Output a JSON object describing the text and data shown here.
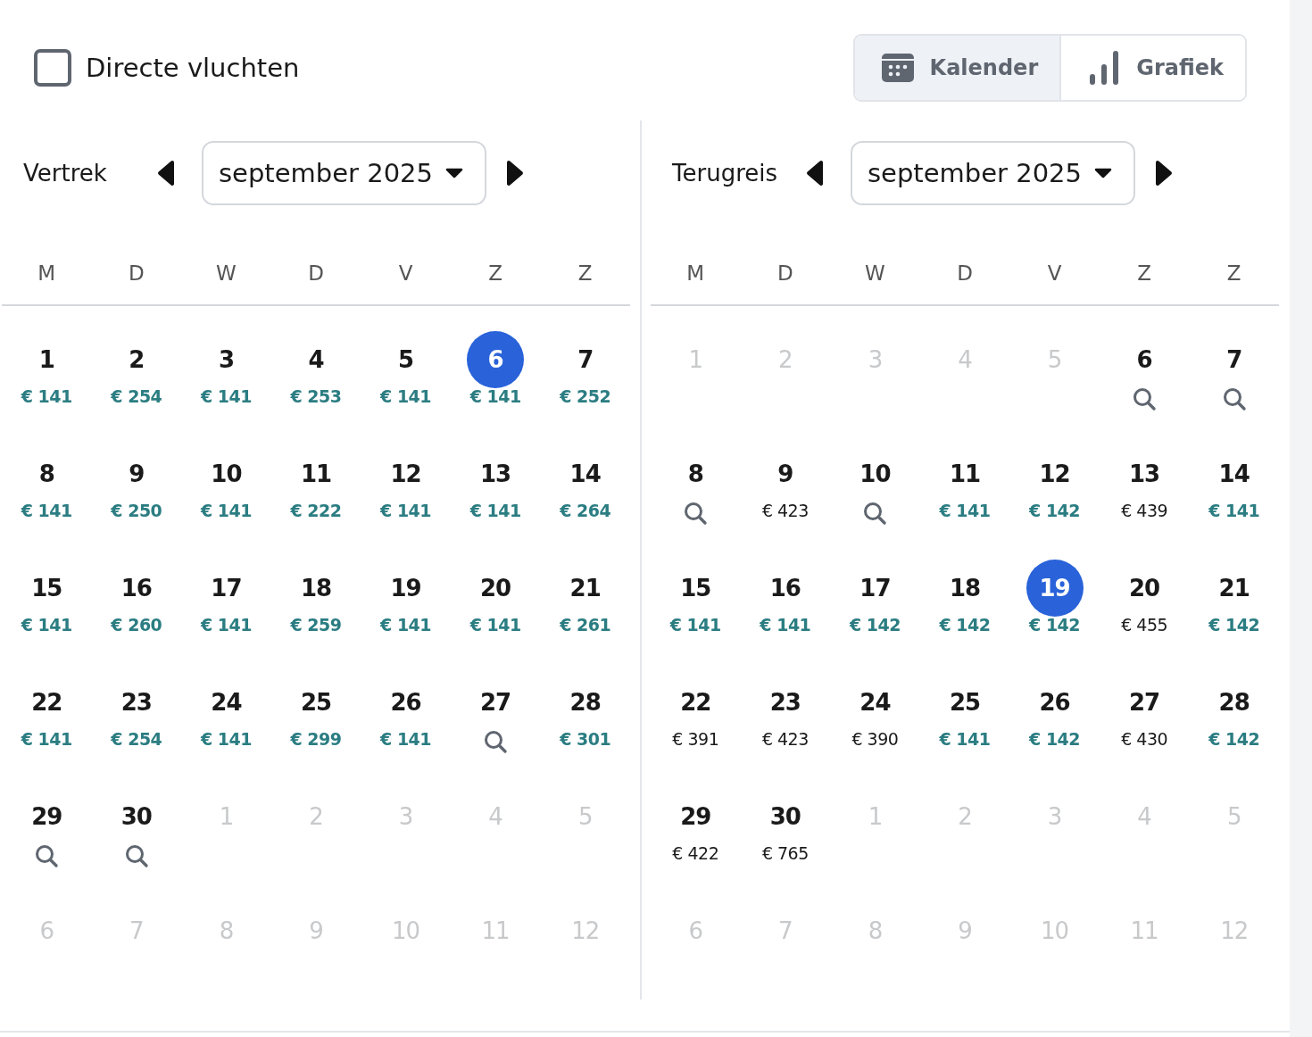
{
  "direct_flights": {
    "label": "Directe vluchten",
    "checked": false
  },
  "view_tabs": [
    {
      "label": "Kalender",
      "selected": true
    },
    {
      "label": "Grafiek",
      "selected": false
    }
  ],
  "calendars": [
    {
      "label": "Vertrek",
      "month": "september 2025",
      "weekdays": [
        "M",
        "D",
        "W",
        "D",
        "V",
        "Z",
        "Z"
      ],
      "days": [
        {
          "day": "1",
          "kind": "price",
          "price": "€ 141",
          "cheap": true,
          "selected": false
        },
        {
          "day": "2",
          "kind": "price",
          "price": "€ 254",
          "cheap": true,
          "selected": false
        },
        {
          "day": "3",
          "kind": "price",
          "price": "€ 141",
          "cheap": true,
          "selected": false
        },
        {
          "day": "4",
          "kind": "price",
          "price": "€ 253",
          "cheap": true,
          "selected": false
        },
        {
          "day": "5",
          "kind": "price",
          "price": "€ 141",
          "cheap": true,
          "selected": false
        },
        {
          "day": "6",
          "kind": "price",
          "price": "€ 141",
          "cheap": true,
          "selected": true
        },
        {
          "day": "7",
          "kind": "price",
          "price": "€ 252",
          "cheap": true,
          "selected": false
        },
        {
          "day": "8",
          "kind": "price",
          "price": "€ 141",
          "cheap": true,
          "selected": false
        },
        {
          "day": "9",
          "kind": "price",
          "price": "€ 250",
          "cheap": true,
          "selected": false
        },
        {
          "day": "10",
          "kind": "price",
          "price": "€ 141",
          "cheap": true,
          "selected": false
        },
        {
          "day": "11",
          "kind": "price",
          "price": "€ 222",
          "cheap": true,
          "selected": false
        },
        {
          "day": "12",
          "kind": "price",
          "price": "€ 141",
          "cheap": true,
          "selected": false
        },
        {
          "day": "13",
          "kind": "price",
          "price": "€ 141",
          "cheap": true,
          "selected": false
        },
        {
          "day": "14",
          "kind": "price",
          "price": "€ 264",
          "cheap": true,
          "selected": false
        },
        {
          "day": "15",
          "kind": "price",
          "price": "€ 141",
          "cheap": true,
          "selected": false
        },
        {
          "day": "16",
          "kind": "price",
          "price": "€ 260",
          "cheap": true,
          "selected": false
        },
        {
          "day": "17",
          "kind": "price",
          "price": "€ 141",
          "cheap": true,
          "selected": false
        },
        {
          "day": "18",
          "kind": "price",
          "price": "€ 259",
          "cheap": true,
          "selected": false
        },
        {
          "day": "19",
          "kind": "price",
          "price": "€ 141",
          "cheap": true,
          "selected": false
        },
        {
          "day": "20",
          "kind": "price",
          "price": "€ 141",
          "cheap": true,
          "selected": false
        },
        {
          "day": "21",
          "kind": "price",
          "price": "€ 261",
          "cheap": true,
          "selected": false
        },
        {
          "day": "22",
          "kind": "price",
          "price": "€ 141",
          "cheap": true,
          "selected": false
        },
        {
          "day": "23",
          "kind": "price",
          "price": "€ 254",
          "cheap": true,
          "selected": false
        },
        {
          "day": "24",
          "kind": "price",
          "price": "€ 141",
          "cheap": true,
          "selected": false
        },
        {
          "day": "25",
          "kind": "price",
          "price": "€ 299",
          "cheap": true,
          "selected": false
        },
        {
          "day": "26",
          "kind": "price",
          "price": "€ 141",
          "cheap": true,
          "selected": false
        },
        {
          "day": "27",
          "kind": "search",
          "selected": false
        },
        {
          "day": "28",
          "kind": "price",
          "price": "€ 301",
          "cheap": true,
          "selected": false
        },
        {
          "day": "29",
          "kind": "search",
          "selected": false
        },
        {
          "day": "30",
          "kind": "search",
          "selected": false
        },
        {
          "day": "1",
          "kind": "outside",
          "selected": false
        },
        {
          "day": "2",
          "kind": "outside",
          "selected": false
        },
        {
          "day": "3",
          "kind": "outside",
          "selected": false
        },
        {
          "day": "4",
          "kind": "outside",
          "selected": false
        },
        {
          "day": "5",
          "kind": "outside",
          "selected": false
        },
        {
          "day": "6",
          "kind": "outside",
          "selected": false
        },
        {
          "day": "7",
          "kind": "outside",
          "selected": false
        },
        {
          "day": "8",
          "kind": "outside",
          "selected": false
        },
        {
          "day": "9",
          "kind": "outside",
          "selected": false
        },
        {
          "day": "10",
          "kind": "outside",
          "selected": false
        },
        {
          "day": "11",
          "kind": "outside",
          "selected": false
        },
        {
          "day": "12",
          "kind": "outside",
          "selected": false
        }
      ]
    },
    {
      "label": "Terugreis",
      "month": "september 2025",
      "weekdays": [
        "M",
        "D",
        "W",
        "D",
        "V",
        "Z",
        "Z"
      ],
      "days": [
        {
          "day": "1",
          "kind": "outside",
          "selected": false
        },
        {
          "day": "2",
          "kind": "outside",
          "selected": false
        },
        {
          "day": "3",
          "kind": "outside",
          "selected": false
        },
        {
          "day": "4",
          "kind": "outside",
          "selected": false
        },
        {
          "day": "5",
          "kind": "outside",
          "selected": false
        },
        {
          "day": "6",
          "kind": "search",
          "selected": false
        },
        {
          "day": "7",
          "kind": "search",
          "selected": false
        },
        {
          "day": "8",
          "kind": "search",
          "selected": false
        },
        {
          "day": "9",
          "kind": "price",
          "price": "€ 423",
          "cheap": false,
          "selected": false
        },
        {
          "day": "10",
          "kind": "search",
          "selected": false
        },
        {
          "day": "11",
          "kind": "price",
          "price": "€ 141",
          "cheap": true,
          "selected": false
        },
        {
          "day": "12",
          "kind": "price",
          "price": "€ 142",
          "cheap": true,
          "selected": false
        },
        {
          "day": "13",
          "kind": "price",
          "price": "€ 439",
          "cheap": false,
          "selected": false
        },
        {
          "day": "14",
          "kind": "price",
          "price": "€ 141",
          "cheap": true,
          "selected": false
        },
        {
          "day": "15",
          "kind": "price",
          "price": "€ 141",
          "cheap": true,
          "selected": false
        },
        {
          "day": "16",
          "kind": "price",
          "price": "€ 141",
          "cheap": true,
          "selected": false
        },
        {
          "day": "17",
          "kind": "price",
          "price": "€ 142",
          "cheap": true,
          "selected": false
        },
        {
          "day": "18",
          "kind": "price",
          "price": "€ 142",
          "cheap": true,
          "selected": false
        },
        {
          "day": "19",
          "kind": "price",
          "price": "€ 142",
          "cheap": true,
          "selected": true
        },
        {
          "day": "20",
          "kind": "price",
          "price": "€ 455",
          "cheap": false,
          "selected": false
        },
        {
          "day": "21",
          "kind": "price",
          "price": "€ 142",
          "cheap": true,
          "selected": false
        },
        {
          "day": "22",
          "kind": "price",
          "price": "€ 391",
          "cheap": false,
          "selected": false
        },
        {
          "day": "23",
          "kind": "price",
          "price": "€ 423",
          "cheap": false,
          "selected": false
        },
        {
          "day": "24",
          "kind": "price",
          "price": "€ 390",
          "cheap": false,
          "selected": false
        },
        {
          "day": "25",
          "kind": "price",
          "price": "€ 141",
          "cheap": true,
          "selected": false
        },
        {
          "day": "26",
          "kind": "price",
          "price": "€ 142",
          "cheap": true,
          "selected": false
        },
        {
          "day": "27",
          "kind": "price",
          "price": "€ 430",
          "cheap": false,
          "selected": false
        },
        {
          "day": "28",
          "kind": "price",
          "price": "€ 142",
          "cheap": true,
          "selected": false
        },
        {
          "day": "29",
          "kind": "price",
          "price": "€ 422",
          "cheap": false,
          "selected": false
        },
        {
          "day": "30",
          "kind": "price",
          "price": "€ 765",
          "cheap": false,
          "selected": false
        },
        {
          "day": "1",
          "kind": "outside",
          "selected": false
        },
        {
          "day": "2",
          "kind": "outside",
          "selected": false
        },
        {
          "day": "3",
          "kind": "outside",
          "selected": false
        },
        {
          "day": "4",
          "kind": "outside",
          "selected": false
        },
        {
          "day": "5",
          "kind": "outside",
          "selected": false
        },
        {
          "day": "6",
          "kind": "outside",
          "selected": false
        },
        {
          "day": "7",
          "kind": "outside",
          "selected": false
        },
        {
          "day": "8",
          "kind": "outside",
          "selected": false
        },
        {
          "day": "9",
          "kind": "outside",
          "selected": false
        },
        {
          "day": "10",
          "kind": "outside",
          "selected": false
        },
        {
          "day": "11",
          "kind": "outside",
          "selected": false
        },
        {
          "day": "12",
          "kind": "outside",
          "selected": false
        }
      ]
    }
  ]
}
